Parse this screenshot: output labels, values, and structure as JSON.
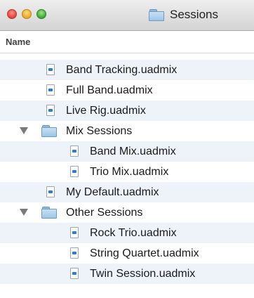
{
  "window": {
    "title": "Sessions",
    "title_icon": "folder-icon"
  },
  "header": {
    "name_label": "Name"
  },
  "items": [
    {
      "label": "Band Tracking.uadmix",
      "type": "file",
      "icon": "document-icon"
    },
    {
      "label": "Full Band.uadmix",
      "type": "file",
      "icon": "document-icon"
    },
    {
      "label": "Live Rig.uadmix",
      "type": "file",
      "icon": "document-icon"
    },
    {
      "label": "Mix Sessions",
      "type": "folder",
      "icon": "folder-icon",
      "expanded": true
    },
    {
      "label": "Band Mix.uadmix",
      "type": "file",
      "icon": "document-icon"
    },
    {
      "label": "Trio Mix.uadmix",
      "type": "file",
      "icon": "document-icon"
    },
    {
      "label": "My Default.uadmix",
      "type": "file",
      "icon": "document-icon"
    },
    {
      "label": "Other Sessions",
      "type": "folder",
      "icon": "folder-icon",
      "expanded": true
    },
    {
      "label": "Rock Trio.uadmix",
      "type": "file",
      "icon": "document-icon"
    },
    {
      "label": "String Quartet.uadmix",
      "type": "file",
      "icon": "document-icon"
    },
    {
      "label": "Twin Session.uadmix",
      "type": "file",
      "icon": "document-icon"
    }
  ]
}
